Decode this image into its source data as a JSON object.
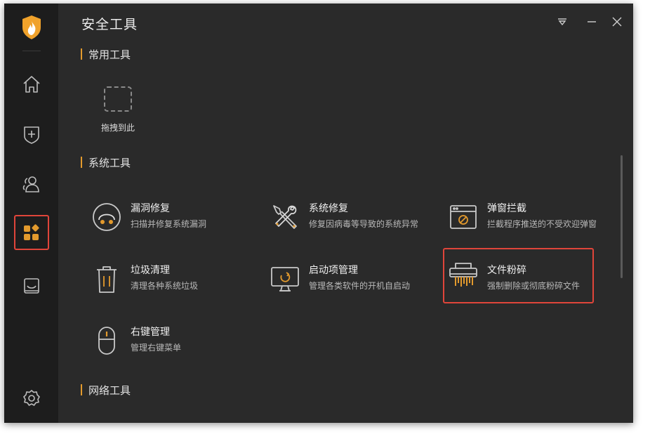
{
  "app": {
    "title": "安全工具",
    "accent": "#e39a2d",
    "highlight": "#e0453a"
  },
  "window_controls": [
    "menu-dropdown-icon",
    "minimize-icon",
    "close-icon"
  ],
  "sidebar": {
    "logo": "flame-shield-logo",
    "items": [
      {
        "icon": "home-icon",
        "active": false
      },
      {
        "icon": "shield-plus-icon",
        "active": false
      },
      {
        "icon": "users-icon",
        "active": false
      },
      {
        "icon": "apps-icon",
        "active": true
      },
      {
        "icon": "tray-icon",
        "active": false
      },
      {
        "icon": "settings-icon",
        "active": false
      }
    ]
  },
  "sections": {
    "common": {
      "label": "常用工具",
      "drop_label": "拖拽到此"
    },
    "system": {
      "label": "系统工具",
      "tools": [
        {
          "name": "漏洞修复",
          "desc": "扫描并修复系统漏洞",
          "icon": "vulnerability-icon"
        },
        {
          "name": "系统修复",
          "desc": "修复因病毒等导致的系统异常",
          "icon": "wrench-screwdriver-icon"
        },
        {
          "name": "弹窗拦截",
          "desc": "拦截程序推送的不受欢迎弹窗",
          "icon": "popup-block-icon"
        },
        {
          "name": "垃圾清理",
          "desc": "清理各种系统垃圾",
          "icon": "trash-icon"
        },
        {
          "name": "启动项管理",
          "desc": "管理各类软件的开机自启动",
          "icon": "monitor-startup-icon"
        },
        {
          "name": "文件粉碎",
          "desc": "强制删除或彻底粉碎文件",
          "icon": "shredder-icon",
          "highlighted": true
        },
        {
          "name": "右键管理",
          "desc": "管理右键菜单",
          "icon": "mouse-icon"
        }
      ]
    },
    "network": {
      "label": "网络工具"
    }
  }
}
